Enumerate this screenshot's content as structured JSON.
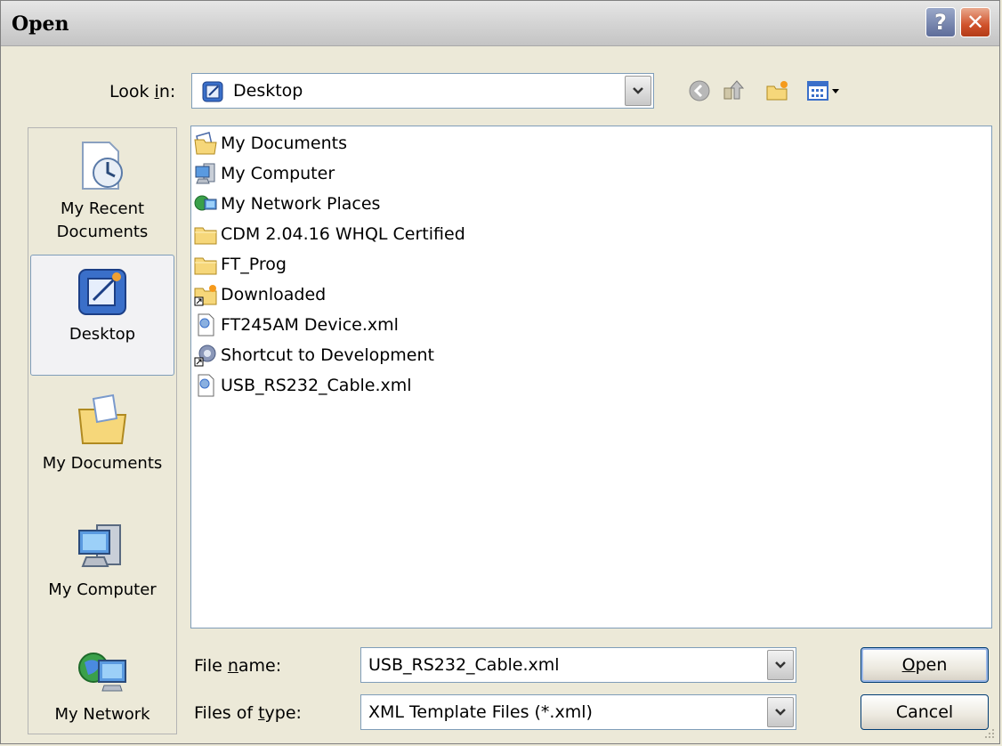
{
  "window": {
    "title": "Open",
    "help_glyph": "?",
    "close_glyph": "✕"
  },
  "lookin": {
    "label_pre": "Look ",
    "label_u": "i",
    "label_post": "n:",
    "value": "Desktop"
  },
  "toolbar": {
    "icons": [
      "back-icon",
      "up-folder-icon",
      "new-folder-icon",
      "views-menu-icon"
    ]
  },
  "places": [
    {
      "label": "My Recent Documents",
      "icon": "recent-documents-icon"
    },
    {
      "label": "Desktop",
      "icon": "desktop-icon",
      "selected": true
    },
    {
      "label": "My Documents",
      "icon": "my-documents-icon"
    },
    {
      "label": "My Computer",
      "icon": "my-computer-icon"
    },
    {
      "label": "My Network",
      "icon": "my-network-icon"
    }
  ],
  "files": [
    {
      "name": "My Documents",
      "icon": "documents-folder-icon"
    },
    {
      "name": "My Computer",
      "icon": "computer-icon"
    },
    {
      "name": "My Network Places",
      "icon": "network-icon"
    },
    {
      "name": "CDM 2.04.16 WHQL Certified",
      "icon": "folder-icon"
    },
    {
      "name": "FT_Prog",
      "icon": "folder-icon"
    },
    {
      "name": "Downloaded",
      "icon": "folder-shortcut-icon"
    },
    {
      "name": "FT245AM Device.xml",
      "icon": "xml-file-icon"
    },
    {
      "name": "Shortcut to Development",
      "icon": "shortcut-icon"
    },
    {
      "name": "USB_RS232_Cable.xml",
      "icon": "xml-file-icon"
    }
  ],
  "filename": {
    "label_pre": "File ",
    "label_u": "n",
    "label_post": "ame:",
    "value": "USB_RS232_Cable.xml"
  },
  "filetype": {
    "label_pre": "Files of ",
    "label_u": "t",
    "label_post": "ype:",
    "value": "XML Template Files (*.xml)"
  },
  "buttons": {
    "open_u": "O",
    "open_rest": "pen",
    "cancel": "Cancel"
  }
}
